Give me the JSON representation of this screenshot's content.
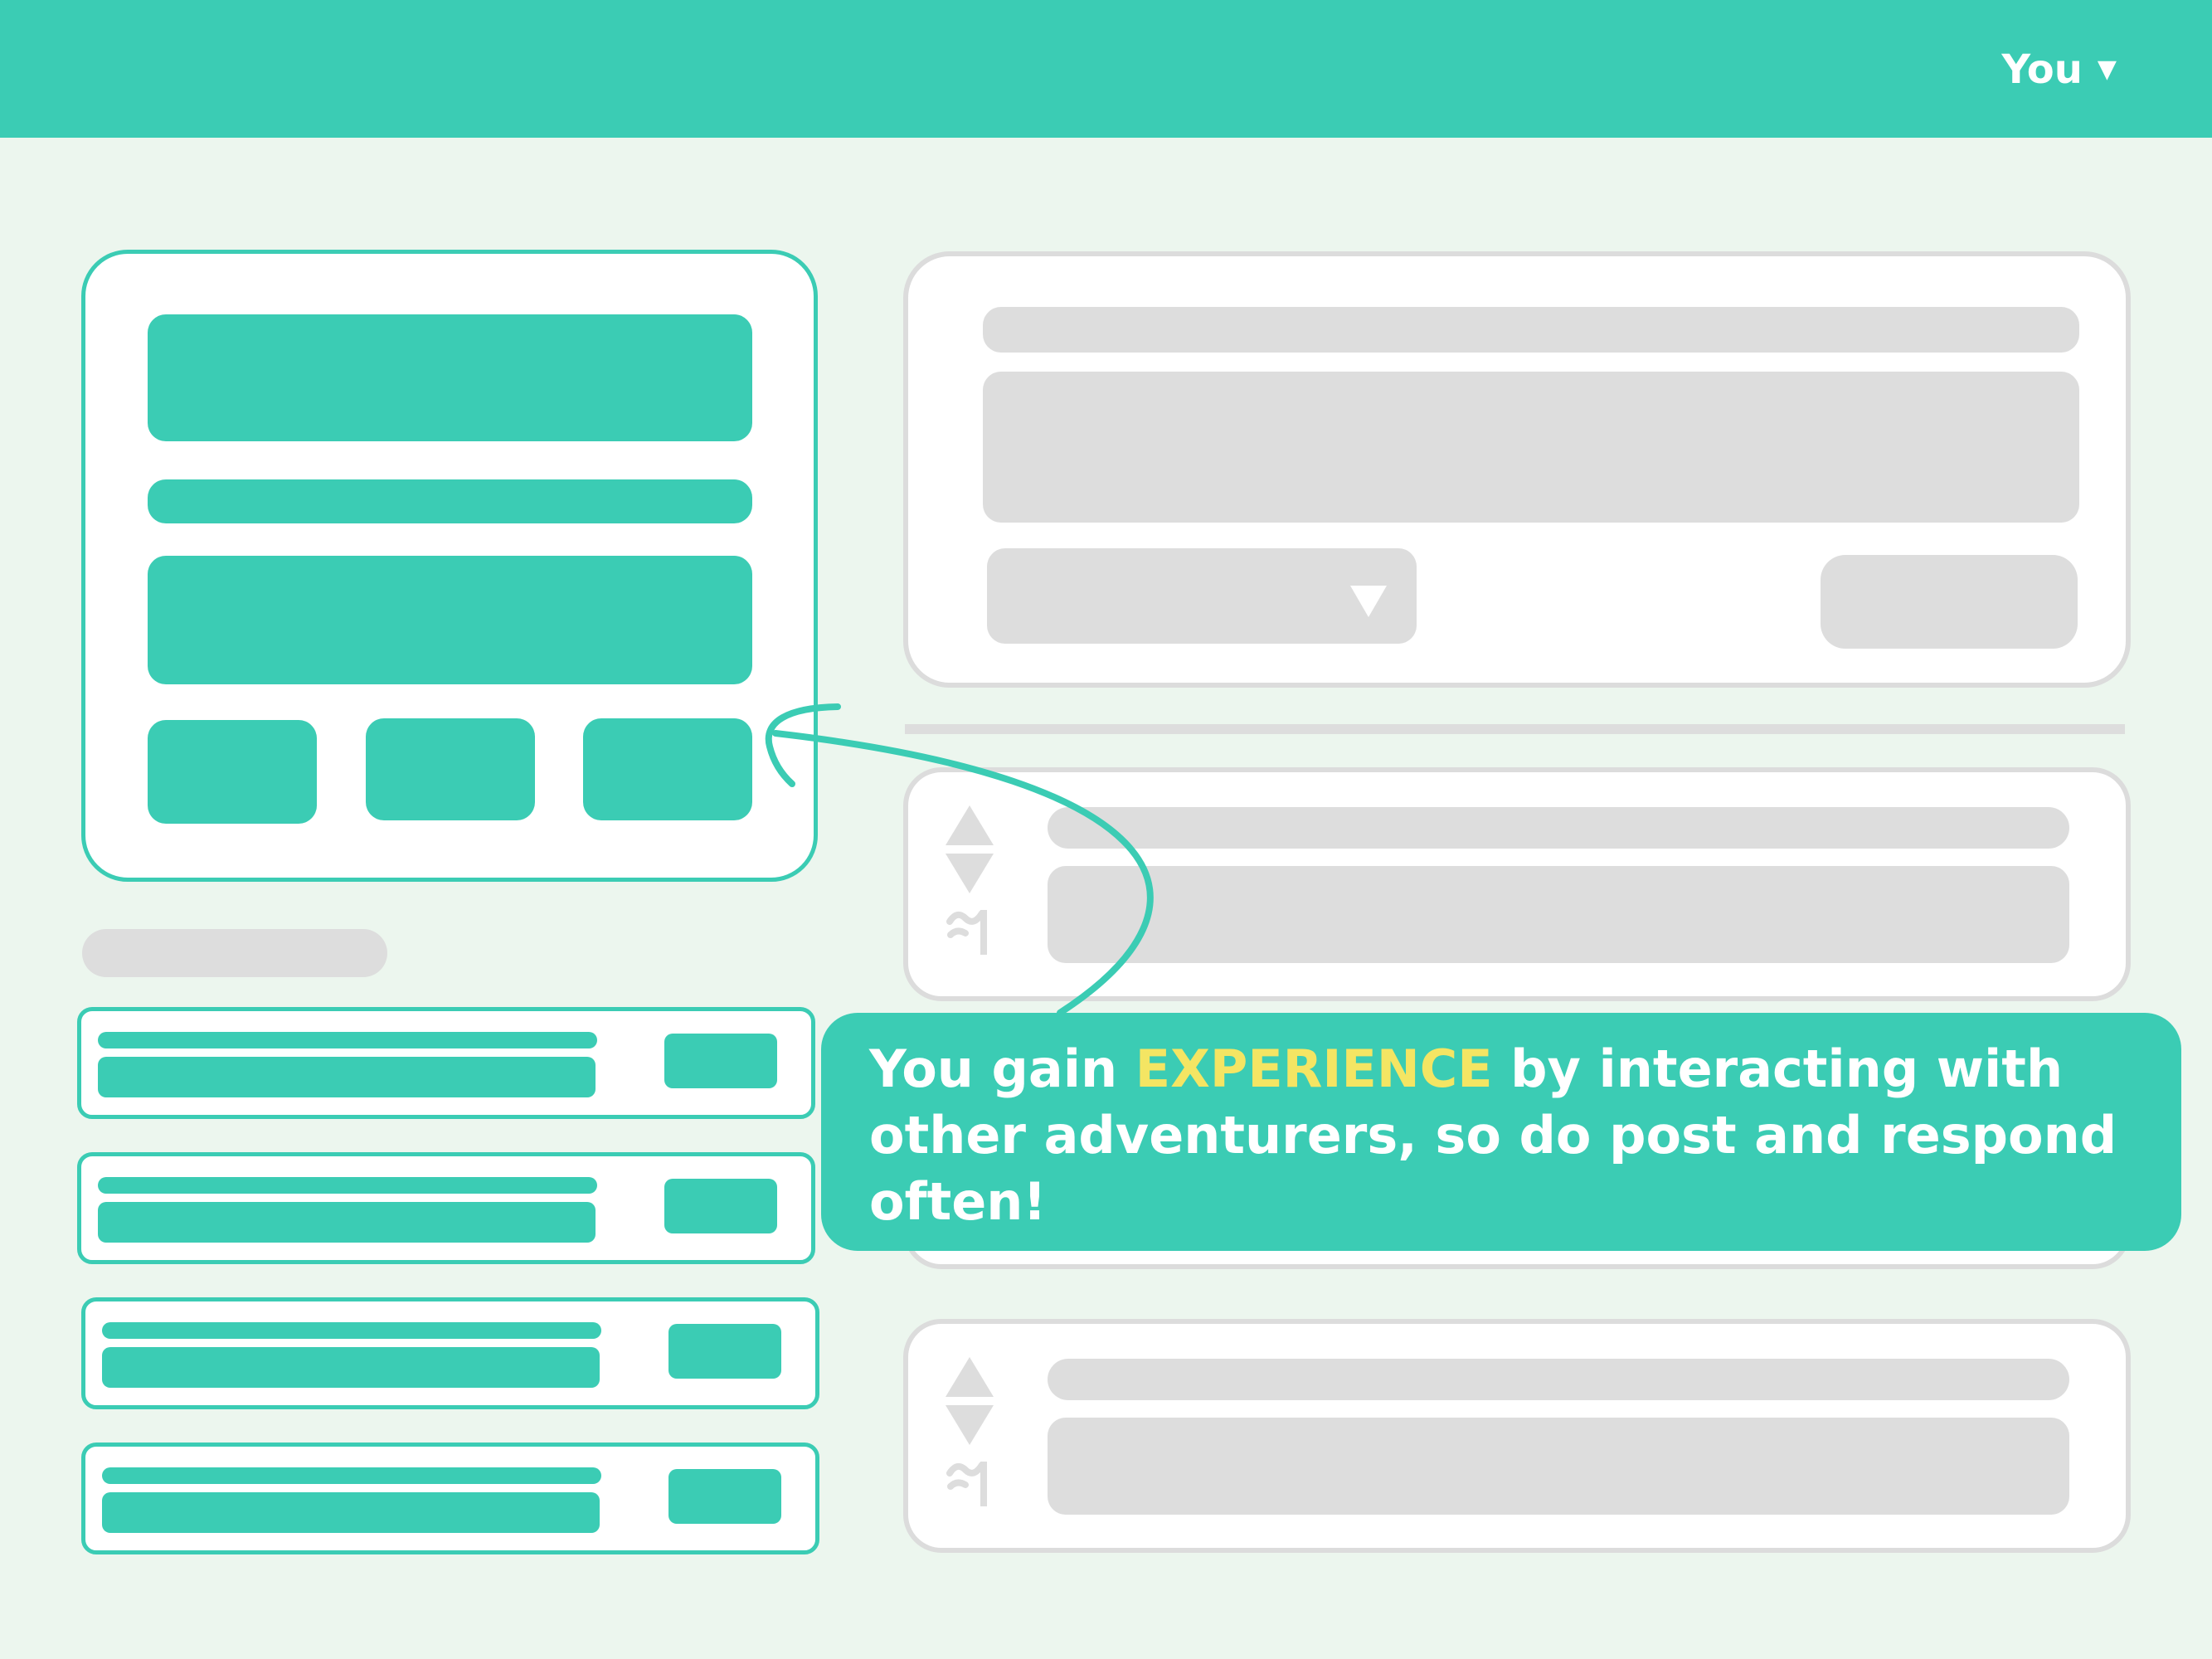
{
  "header": {
    "user_label": "You",
    "caret_icon": "triangle-down",
    "background": "#3bccb4"
  },
  "callout": {
    "text_before": "You gain ",
    "highlight": "EXPERIENCE",
    "text_after": " by interacting with other adventurers, so do post and respond often!",
    "highlight_color": "#f4e563"
  },
  "colors": {
    "accent": "#3bccb4",
    "page_background": "#ecf6ee",
    "placeholder": "#dddddd"
  }
}
